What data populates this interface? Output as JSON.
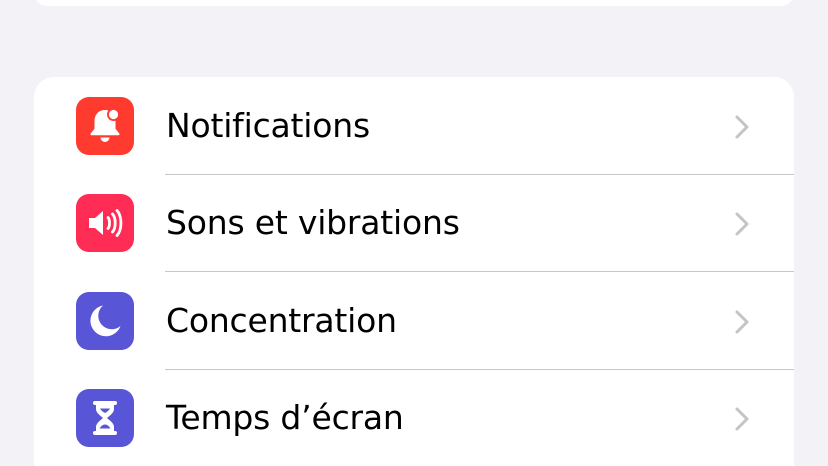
{
  "settings": {
    "items": [
      {
        "label": "Notifications",
        "icon": "bell-badge-icon",
        "color": "#ff3b30"
      },
      {
        "label": "Sons et vibrations",
        "icon": "speaker-wave-icon",
        "color": "#ff2d55"
      },
      {
        "label": "Concentration",
        "icon": "moon-icon",
        "color": "#5856d6"
      },
      {
        "label": "Temps d’écran",
        "icon": "hourglass-icon",
        "color": "#5856d6"
      }
    ]
  }
}
